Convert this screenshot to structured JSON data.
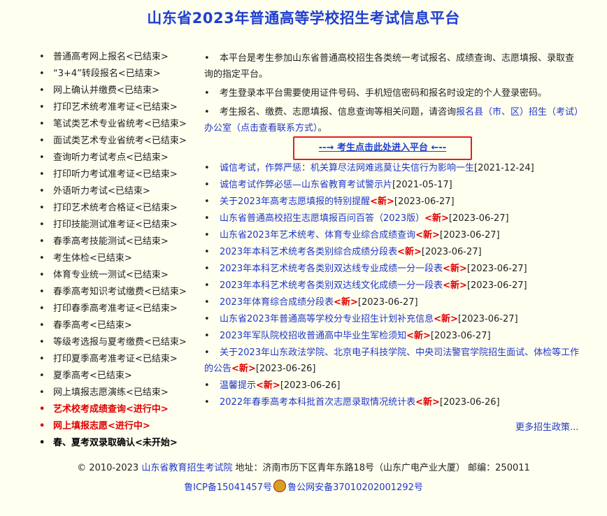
{
  "title": "山东省2023年普通高等学校招生考试信息平台",
  "left_menu": [
    {
      "label": "普通高考网上报名<已结束>",
      "state": "ended"
    },
    {
      "label": "“3+4”转段报名<已结束>",
      "state": "ended"
    },
    {
      "label": "网上确认并缴费<已结束>",
      "state": "ended"
    },
    {
      "label": "打印艺术统考准考证<已结束>",
      "state": "ended"
    },
    {
      "label": "笔试类艺术专业省统考<已结束>",
      "state": "ended"
    },
    {
      "label": "面试类艺术专业省统考<已结束>",
      "state": "ended"
    },
    {
      "label": "查询听力考试考点<已结束>",
      "state": "ended"
    },
    {
      "label": "打印听力考试准考证<已结束>",
      "state": "ended"
    },
    {
      "label": "外语听力考试<已结束>",
      "state": "ended"
    },
    {
      "label": "打印艺术统考合格证<已结束>",
      "state": "ended"
    },
    {
      "label": "打印技能测试准考证<已结束>",
      "state": "ended"
    },
    {
      "label": "春季高考技能测试<已结束>",
      "state": "ended"
    },
    {
      "label": "考生体检<已结束>",
      "state": "ended"
    },
    {
      "label": "体育专业统一测试<已结束>",
      "state": "ended"
    },
    {
      "label": "春季高考知识考试缴费<已结束>",
      "state": "ended"
    },
    {
      "label": "打印春季高考准考证<已结束>",
      "state": "ended"
    },
    {
      "label": "春季高考<已结束>",
      "state": "ended"
    },
    {
      "label": "等级考选报与夏考缴费<已结束>",
      "state": "ended"
    },
    {
      "label": "打印夏季高考准考证<已结束>",
      "state": "ended"
    },
    {
      "label": "夏季高考<已结束>",
      "state": "ended"
    },
    {
      "label": "网上填报志愿演练<已结束>",
      "state": "ended"
    },
    {
      "label": "艺术校考成绩查询<进行中>",
      "state": "active"
    },
    {
      "label": "网上填报志愿<进行中>",
      "state": "active"
    },
    {
      "label": "春、夏考双录取确认<未开始>",
      "state": "pending"
    }
  ],
  "intro": {
    "p1": "本平台是考生参加山东省普通高校招生各类统一考试报名、成绩查询、志愿填报、录取查询的指定平台。",
    "p2": "考生登录本平台需要使用证件号码、手机短信密码和报名时设定的个人登录密码。",
    "p3_text": "考生报名、缴费、志愿填报、信息查询等相关问题，请咨询",
    "p3_link": "报名县（市、区）招生（考试）办公室（点击查看联系方式）",
    "p3_end": "。"
  },
  "enter_button": "--→ 考生点击此处进入平台 ←--",
  "news": [
    {
      "title": "诚信考试，作弊严惩：机关算尽法网难逃莫让失信行为影响一生",
      "new": false,
      "date": "[2021-12-24]"
    },
    {
      "title": "诚信考试作弊必惩—山东省教育考试警示片",
      "new": false,
      "date": "[2021-05-17]"
    },
    {
      "title": "关于2023年高考志愿填报的特别提醒",
      "new": true,
      "date": "[2023-06-27]"
    },
    {
      "title": "山东省普通高校招生志愿填报百问百答（2023版）",
      "new": true,
      "date": "[2023-06-27]"
    },
    {
      "title": "山东省2023年艺术统考、体育专业综合成绩查询",
      "new": true,
      "date": "[2023-06-27]"
    },
    {
      "title": "2023年本科艺术统考各类别综合成绩分段表",
      "new": true,
      "date": "[2023-06-27]"
    },
    {
      "title": "2023年本科艺术统考各类别双达线专业成绩一分一段表",
      "new": true,
      "date": "[2023-06-27]"
    },
    {
      "title": "2023年本科艺术统考各类别双达线文化成绩一分一段表",
      "new": true,
      "date": "[2023-06-27]"
    },
    {
      "title": "2023年体育综合成绩分段表",
      "new": true,
      "date": "[2023-06-27]"
    },
    {
      "title": "山东省2023年普通高等学校分专业招生计划补充信息",
      "new": true,
      "date": "[2023-06-27]"
    },
    {
      "title": "2023年军队院校招收普通高中毕业生军检须知",
      "new": true,
      "date": "[2023-06-27]"
    },
    {
      "title": "关于2023年山东政法学院、北京电子科技学院、中央司法警官学院招生面试、体检等工作的公告",
      "new": true,
      "date": "[2023-06-26]"
    },
    {
      "title": "温馨提示",
      "new": true,
      "date": "[2023-06-26]"
    },
    {
      "title": "2022年春季高考本科批首次志愿录取情况统计表",
      "new": true,
      "date": "[2023-06-26]"
    }
  ],
  "new_badge": "<新>",
  "more_link": "更多招生政策...",
  "footer": {
    "copyright": "© 2010-2023",
    "org_link": "山东省教育招生考试院",
    "address": "地址：济南市历下区青年东路18号（山东广电产业大厦） 邮编：250011",
    "icp": "鲁ICP备15041457号",
    "police": "鲁公网安备37010202001292号"
  },
  "colors": {
    "title": "#1f3fd0",
    "link": "#2138c8",
    "active": "#e00000",
    "background": "#fffff0"
  }
}
